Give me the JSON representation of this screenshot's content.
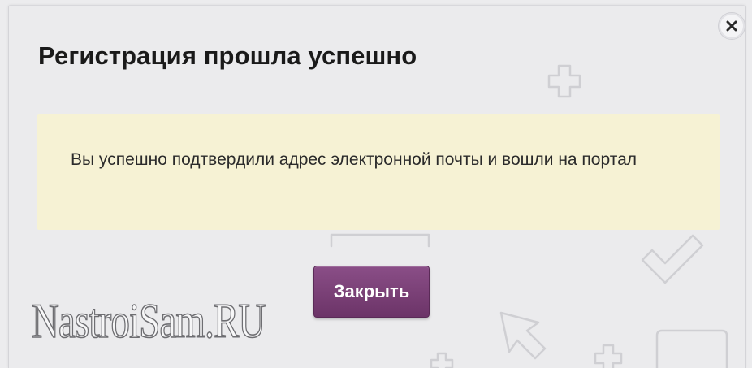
{
  "dialog": {
    "title": "Регистрация прошла успешно",
    "message": "Вы успешно подтвердили адрес электронной почты и вошли на портал",
    "close_button_label": "Закрыть",
    "close_icon": "close-x-icon"
  },
  "watermark": {
    "text": "NastroiSam.RU"
  },
  "colors": {
    "accent": "#7a4277",
    "message_background": "#f6f2d4",
    "dialog_background": "#ebebed"
  }
}
